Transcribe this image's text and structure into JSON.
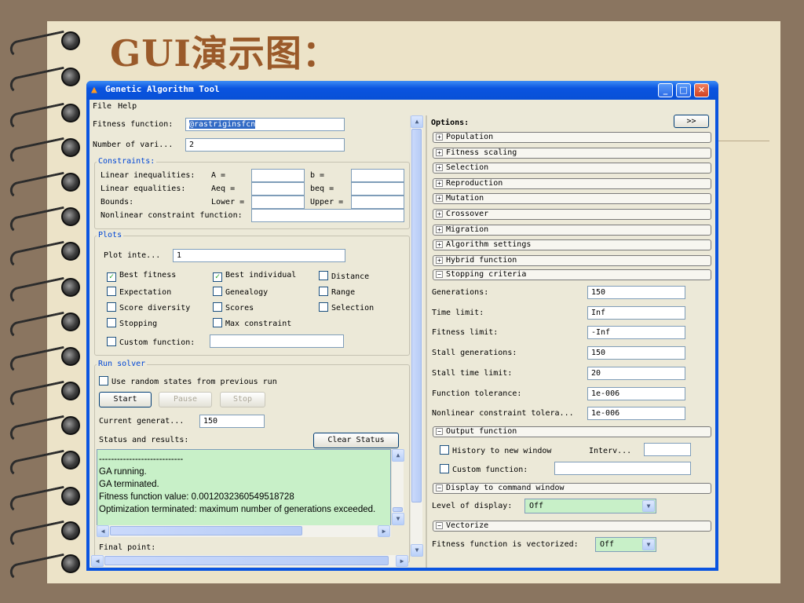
{
  "slide": {
    "title": "GUI演示图："
  },
  "window": {
    "title": "Genetic Algorithm Tool",
    "buttons": {
      "minimize": "_",
      "maximize": "□",
      "close": "✕"
    }
  },
  "menu": [
    "File",
    "Help"
  ],
  "problem": {
    "fitness_label": "Fitness function:",
    "fitness_value": "@rastriginsfcn",
    "nvars_label": "Number of vari...",
    "nvars_value": "2"
  },
  "constraints": {
    "title": "Constraints:",
    "lin_ineq_label": "Linear inequalities:",
    "A_label": "A =",
    "b_label": "b =",
    "lin_eq_label": "Linear equalities:",
    "Aeq_label": "Aeq =",
    "beq_label": "beq =",
    "bounds_label": "Bounds:",
    "lower_label": "Lower =",
    "upper_label": "Upper =",
    "nonlin_label": "Nonlinear constraint function:"
  },
  "plots": {
    "title": "Plots",
    "interval_label": "Plot inte...",
    "interval_value": "1",
    "checkboxes": [
      {
        "label": "Best fitness",
        "checked": true
      },
      {
        "label": "Best individual",
        "checked": true
      },
      {
        "label": "Distance",
        "checked": false
      },
      {
        "label": "Expectation",
        "checked": false
      },
      {
        "label": "Genealogy",
        "checked": false
      },
      {
        "label": "Range",
        "checked": false
      },
      {
        "label": "Score diversity",
        "checked": false
      },
      {
        "label": "Scores",
        "checked": false
      },
      {
        "label": "Selection",
        "checked": false
      },
      {
        "label": "Stopping",
        "checked": false
      },
      {
        "label": "Max constraint",
        "checked": false
      }
    ],
    "custom_label": "Custom function:"
  },
  "run": {
    "title": "Run solver",
    "random_label": "Use random states from previous run",
    "start": "Start",
    "pause": "Pause",
    "stop": "Stop",
    "current_label": "Current generat...",
    "current_value": "150",
    "status_label": "Status and results:",
    "clear": "Clear Status",
    "results_lines": [
      "----------------------------",
      "GA running.",
      "GA terminated.",
      "Fitness function value: 0.0012032360549518728",
      "Optimization terminated: maximum number of generations exceeded."
    ],
    "final_label": "Final point:"
  },
  "options": {
    "title": "Options:",
    "more": ">>",
    "sections": [
      "Population",
      "Fitness scaling",
      "Selection",
      "Reproduction",
      "Mutation",
      "Crossover",
      "Migration",
      "Algorithm settings",
      "Hybrid function"
    ],
    "stopping": {
      "title": "Stopping criteria",
      "rows": [
        {
          "label": "Generations:",
          "value": "150"
        },
        {
          "label": "Time limit:",
          "value": "Inf"
        },
        {
          "label": "Fitness limit:",
          "value": "-Inf"
        },
        {
          "label": "Stall generations:",
          "value": "150"
        },
        {
          "label": "Stall time limit:",
          "value": "20"
        },
        {
          "label": "Function tolerance:",
          "value": "1e-006"
        },
        {
          "label": "Nonlinear constraint tolera...",
          "value": "1e-006"
        }
      ]
    },
    "output": {
      "title": "Output function",
      "history_label": "History to new window",
      "interval_label": "Interv...",
      "custom_label": "Custom function:"
    },
    "display": {
      "title": "Display to command window",
      "level_label": "Level of display:",
      "level_value": "Off"
    },
    "vectorize": {
      "title": "Vectorize",
      "label": "Fitness function is vectorized:",
      "value": "Off"
    }
  }
}
